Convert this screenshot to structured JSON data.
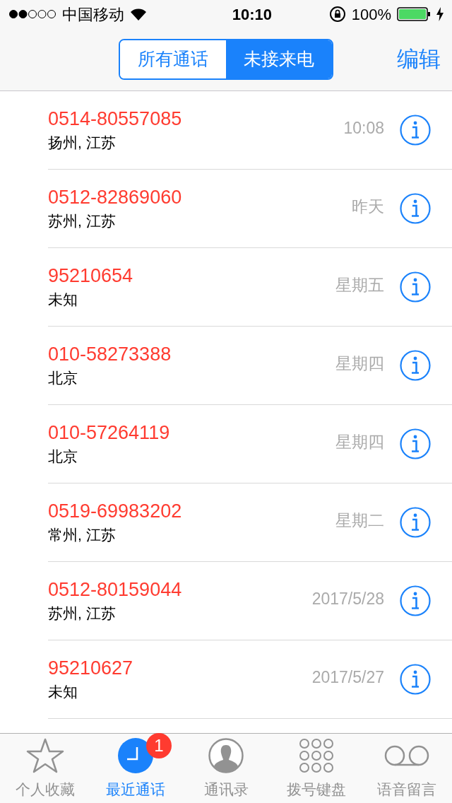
{
  "status_bar": {
    "carrier": "中国移动",
    "time": "10:10",
    "battery": "100%"
  },
  "segments": [
    {
      "label": "所有通话",
      "selected": false
    },
    {
      "label": "未接来电",
      "selected": true
    }
  ],
  "edit_button": "编辑",
  "calls": [
    {
      "number": "0514-80557085",
      "location": "扬州, 江苏",
      "time": "10:08"
    },
    {
      "number": "0512-82869060",
      "location": "苏州, 江苏",
      "time": "昨天"
    },
    {
      "number": "95210654",
      "location": "未知",
      "time": "星期五"
    },
    {
      "number": "010-58273388",
      "location": "北京",
      "time": "星期四"
    },
    {
      "number": "010-57264119",
      "location": "北京",
      "time": "星期四"
    },
    {
      "number": "0519-69983202",
      "location": "常州, 江苏",
      "time": "星期二"
    },
    {
      "number": "0512-80159044",
      "location": "苏州, 江苏",
      "time": "2017/5/28"
    },
    {
      "number": "95210627",
      "location": "未知",
      "time": "2017/5/27"
    }
  ],
  "tab_bar": [
    {
      "kind": "favorites",
      "label": "个人收藏",
      "selected": false
    },
    {
      "kind": "recents",
      "label": "最近通话",
      "selected": true,
      "badge": "1"
    },
    {
      "kind": "contacts",
      "label": "通讯录",
      "selected": false
    },
    {
      "kind": "keypad",
      "label": "拨号键盘",
      "selected": false
    },
    {
      "kind": "voicemail",
      "label": "语音留言",
      "selected": false
    }
  ]
}
